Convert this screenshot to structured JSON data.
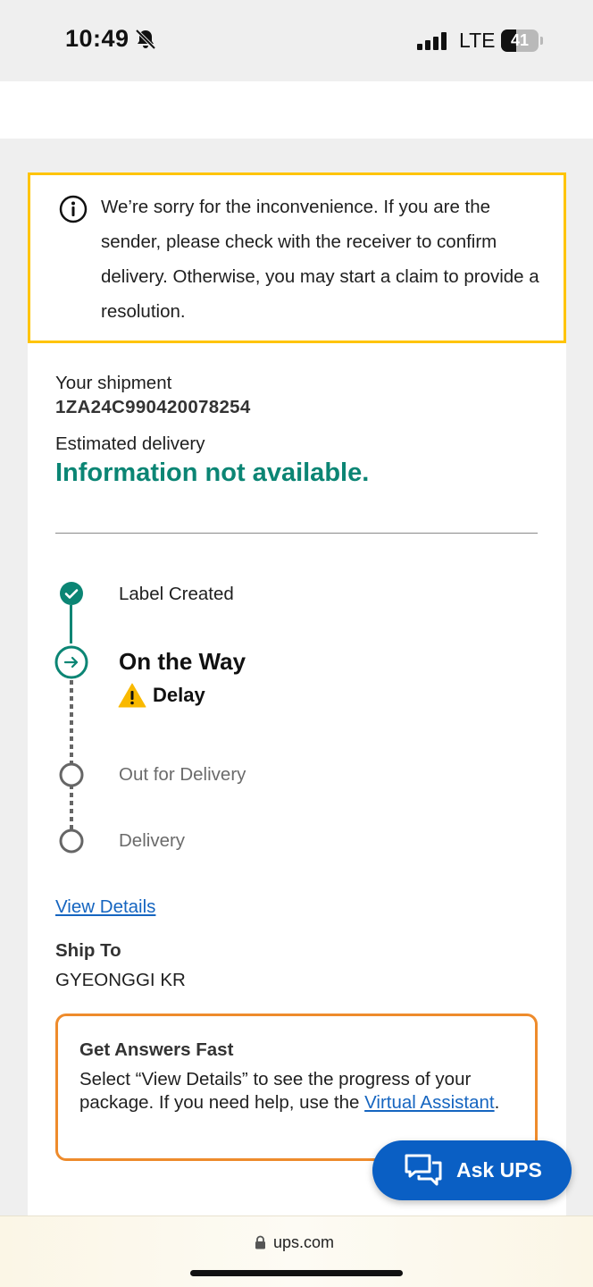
{
  "status_bar": {
    "time": "10:49",
    "network": "LTE",
    "battery_level": "41",
    "battery_fraction": 0.41,
    "icons": [
      "bell-off-icon",
      "signal-icon",
      "battery-icon"
    ]
  },
  "alert": {
    "icon": "info-icon",
    "message": "We’re sorry for the inconvenience. If you are the sender, please check with the receiver to confirm delivery. Otherwise, you may start a claim to provide a resolution."
  },
  "shipment": {
    "label": "Your shipment",
    "tracking_number": "1ZA24C990420078254",
    "estimated_label": "Estimated delivery",
    "estimated_value": "Information not available."
  },
  "progress": {
    "steps": [
      {
        "label": "Label Created",
        "state": "complete"
      },
      {
        "label": "On the Way",
        "state": "current"
      },
      {
        "label": "Out for Delivery",
        "state": "pending"
      },
      {
        "label": "Delivery",
        "state": "pending"
      }
    ],
    "status_note": "Delay"
  },
  "links": {
    "view_details": "View Details"
  },
  "ship_to": {
    "label": "Ship To",
    "value": "GYEONGGI KR"
  },
  "answers": {
    "title": "Get Answers Fast",
    "body_prefix": "Select “View Details” to see the progress of your package. If you need help, use the ",
    "link_text": "Virtual Assistant",
    "body_suffix": "."
  },
  "ask_button": {
    "label": "Ask UPS",
    "icon": "chat-icon"
  },
  "browser": {
    "url": "ups.com"
  },
  "colors": {
    "accent_teal": "#0b8574",
    "alert_border": "#ffc400",
    "answers_border": "#ee8b2c",
    "link_blue": "#1565c0",
    "button_blue": "#0a5fc4",
    "warning_yellow": "#f9b900"
  }
}
